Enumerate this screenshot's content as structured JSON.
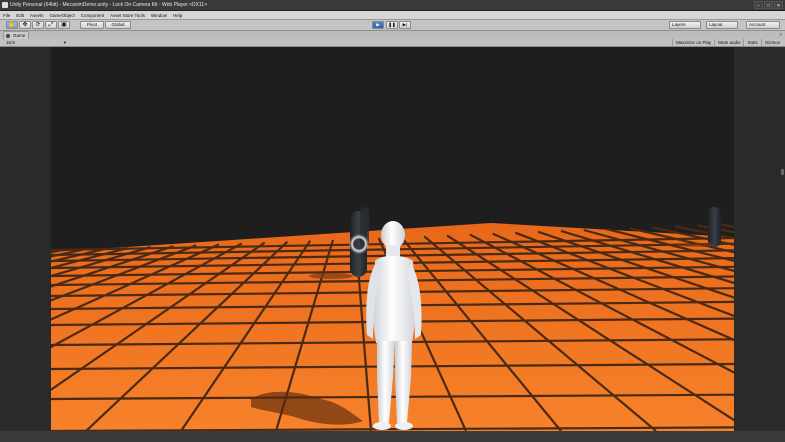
{
  "window": {
    "title": "Unity Personal (64bit) - MecanimDemo.unity - Lock On Camera Kit - Web Player <DX11>",
    "buttons": [
      "–",
      "□",
      "✕"
    ]
  },
  "menu": [
    "File",
    "Edit",
    "Assets",
    "GameObject",
    "Component",
    "Asset Store Tools",
    "Window",
    "Help"
  ],
  "toolbar": {
    "pivot_label": "Pivot",
    "global_label": "Global",
    "layers_label": "Layers",
    "layout_label": "Layout",
    "account_label": "Account"
  },
  "tab": {
    "label": "Game",
    "menu_glyph": "≡"
  },
  "gamebar": {
    "aspect": "16:9",
    "options": [
      "Maximize on Play",
      "Mute audio",
      "Stats",
      "Gizmos"
    ]
  },
  "colors": {
    "floor": "#f3781e",
    "sky": "#1e1e1e",
    "grid": "#4a2a14",
    "capsule": "#2b3036",
    "character": "#eef0f3",
    "play_button": "#3a73ba"
  }
}
